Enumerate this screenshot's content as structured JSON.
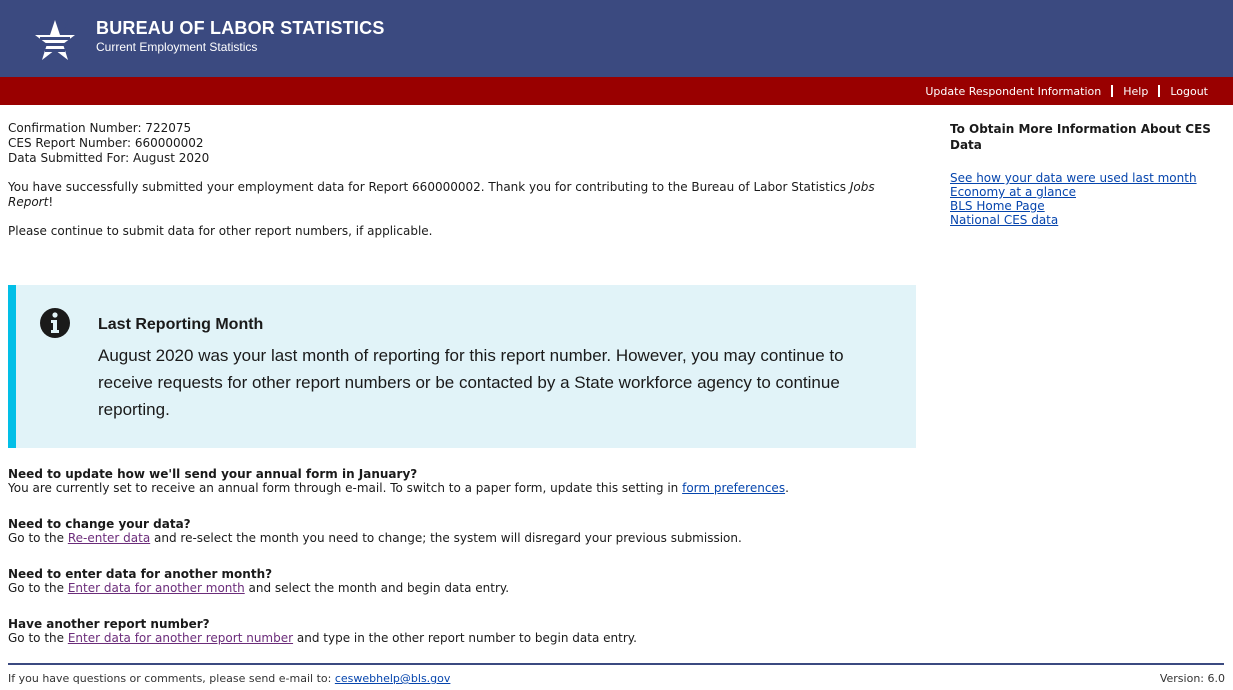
{
  "header": {
    "title": "BUREAU OF LABOR STATISTICS",
    "subtitle": "Current Employment Statistics",
    "logo_icon": "bls-star-logo-icon",
    "bg_color": "#3b4a80"
  },
  "topnav": {
    "bg_color": "#990000",
    "items": [
      "Update Respondent Information",
      "Help",
      "Logout"
    ]
  },
  "confirmation": {
    "confirmation_number": "Confirmation Number: 722075",
    "report_number": "CES Report Number: 660000002",
    "data_submitted": "Data Submitted For: August 2020"
  },
  "message": {
    "success_prefix": "You have successfully submitted your employment data for Report 660000002. Thank you for contributing to the Bureau of Labor Statistics ",
    "success_italic": "Jobs Report",
    "success_suffix": "!",
    "continue_text": "Please continue to submit data for other report numbers, if applicable."
  },
  "alert": {
    "icon": "info-circle-icon",
    "title": "Last Reporting Month",
    "body": "August 2020 was your last month of reporting for this report number. However, you may continue to receive requests for other report numbers or be contacted by a State workforce agency to continue reporting.",
    "bg_color": "#e1f3f8",
    "border_color": "#02bfe7"
  },
  "faq": [
    {
      "question": "Need to update how we'll send your annual form in January?",
      "text_before": "You are currently set to receive an annual form through e-mail. To switch to a paper form, update this setting in ",
      "link": "form preferences",
      "text_after": "."
    },
    {
      "question": "Need to change your data?",
      "text_before": "Go to the ",
      "link": "Re-enter data",
      "text_after": " and re-select the month you need to change; the system will disregard your previous submission."
    },
    {
      "question": "Need to enter data for another month?",
      "text_before": "Go to the ",
      "link": "Enter data for another month",
      "text_after": " and select the month and begin data entry."
    },
    {
      "question": "Have another report number?",
      "text_before": "Go to the ",
      "link": "Enter data for another report number",
      "text_after": " and type in the other report number to begin data entry."
    }
  ],
  "sidebar": {
    "title": "To Obtain More Information About CES Data",
    "links": [
      "See how your data were used last month",
      "Economy at a glance",
      "BLS Home Page",
      "National CES data"
    ]
  },
  "footer": {
    "contact_text": "If you have questions or comments, please send e-mail to: ",
    "email": "ceswebhelp@bls.gov",
    "version": "Version: 6.0"
  }
}
